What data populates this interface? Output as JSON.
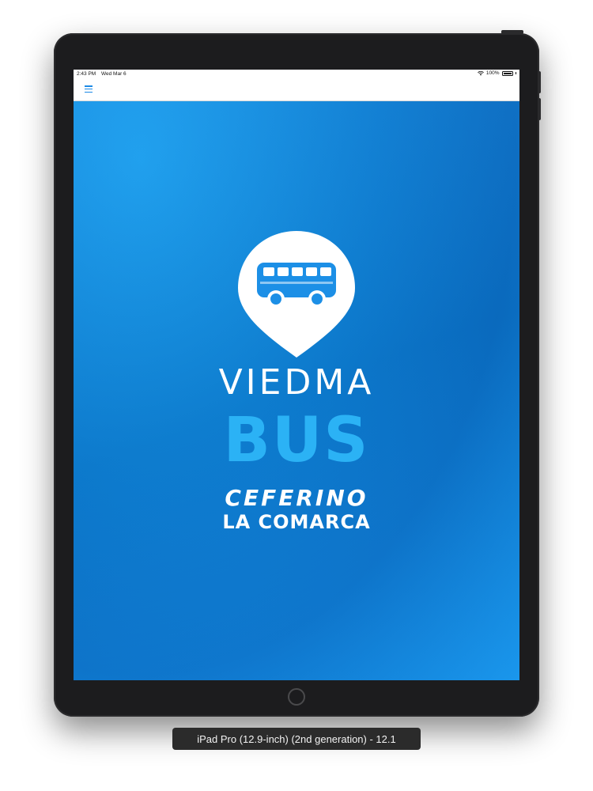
{
  "status_bar": {
    "time": "2:43 PM",
    "date": "Wed Mar 6",
    "battery": "100%"
  },
  "nav": {
    "menu_icon": "hamburger-menu-icon"
  },
  "splash": {
    "logo_icon": "bus-location-pin-icon",
    "line1": "VIEDMA",
    "line2": "BUS",
    "line3": "CEFERINO",
    "line4": "LA COMARCA"
  },
  "simulator": {
    "device_label": "iPad Pro (12.9-inch) (2nd generation) - 12.1"
  },
  "colors": {
    "accent": "#1d8ae6",
    "background_blue": "#0d7fd6",
    "bus_light_blue": "#2bb2f5"
  }
}
